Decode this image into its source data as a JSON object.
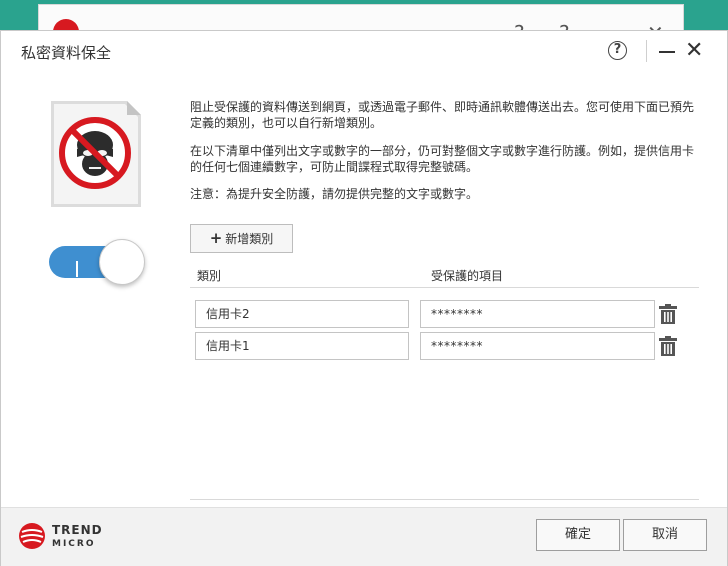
{
  "dialog": {
    "title": "私密資料保全"
  },
  "description": {
    "p1": "阻止受保護的資料傳送到網頁，或透過電子郵件、即時通訊軟體傳送出去。您可使用下面已預先定義的類別，也可以自行新增類別。",
    "p2": "在以下清單中僅列出文字或數字的一部分，仍可對整個文字或數字進行防護。例如，提供信用卡的任何七個連續數字，可防止間諜程式取得完整號碼。",
    "p3": "注意：為提升安全防護，請勿提供完整的文字或數字。"
  },
  "add_button": {
    "label": "新增類別"
  },
  "table": {
    "headers": {
      "category": "類別",
      "item": "受保護的項目"
    },
    "rows": [
      {
        "category": "信用卡2",
        "value": "********"
      },
      {
        "category": "信用卡1",
        "value": "********"
      }
    ]
  },
  "footer": {
    "brand_line1": "TREND",
    "brand_line2": "MICRO",
    "ok_label": "確定",
    "cancel_label": "取消"
  },
  "colors": {
    "toggle_on": "#3f8fd0",
    "brand_red": "#d71920",
    "desktop_bg": "#2aa38e"
  },
  "toggle": {
    "state": "on"
  }
}
